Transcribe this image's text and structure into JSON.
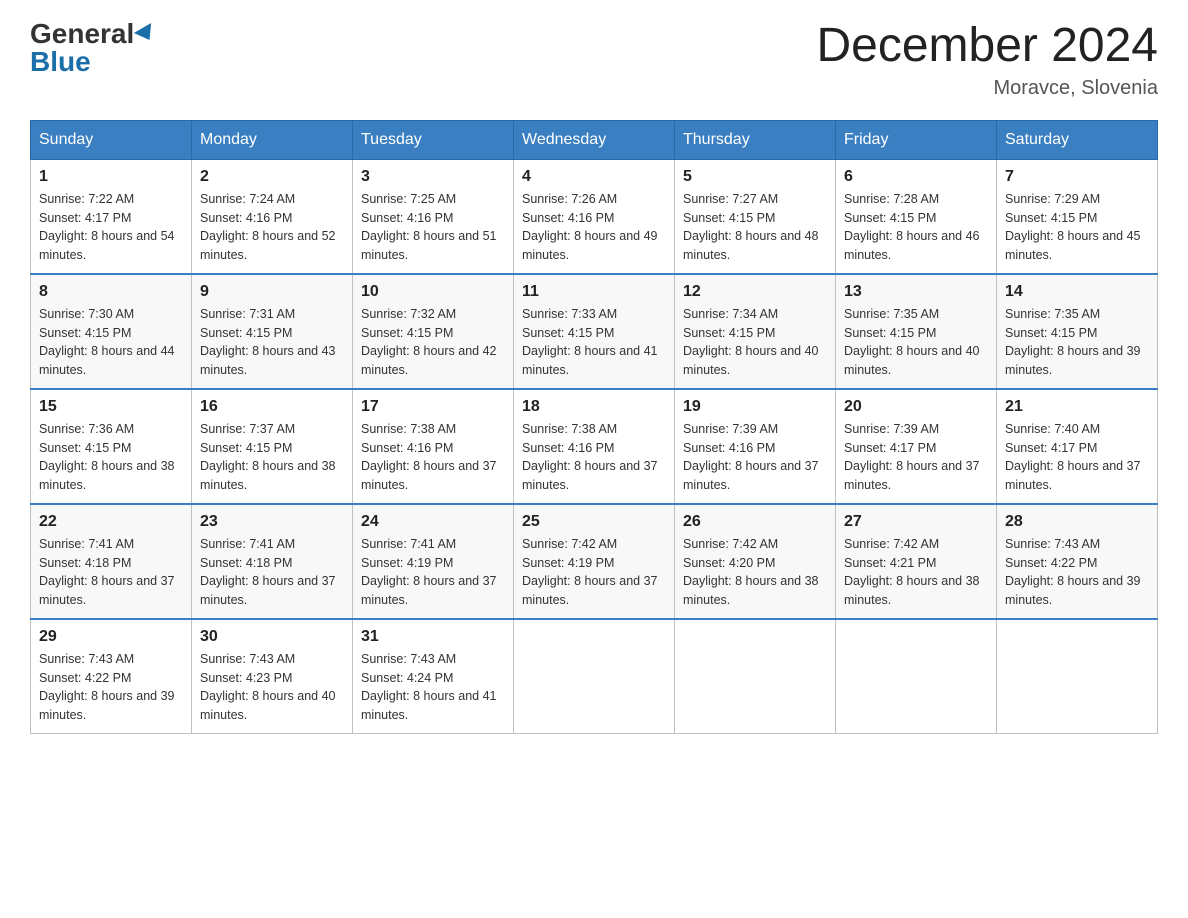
{
  "header": {
    "logo_general": "General",
    "logo_blue": "Blue",
    "month_title": "December 2024",
    "location": "Moravce, Slovenia"
  },
  "weekdays": [
    "Sunday",
    "Monday",
    "Tuesday",
    "Wednesday",
    "Thursday",
    "Friday",
    "Saturday"
  ],
  "weeks": [
    [
      {
        "day": "1",
        "sunrise": "7:22 AM",
        "sunset": "4:17 PM",
        "daylight": "8 hours and 54 minutes."
      },
      {
        "day": "2",
        "sunrise": "7:24 AM",
        "sunset": "4:16 PM",
        "daylight": "8 hours and 52 minutes."
      },
      {
        "day": "3",
        "sunrise": "7:25 AM",
        "sunset": "4:16 PM",
        "daylight": "8 hours and 51 minutes."
      },
      {
        "day": "4",
        "sunrise": "7:26 AM",
        "sunset": "4:16 PM",
        "daylight": "8 hours and 49 minutes."
      },
      {
        "day": "5",
        "sunrise": "7:27 AM",
        "sunset": "4:15 PM",
        "daylight": "8 hours and 48 minutes."
      },
      {
        "day": "6",
        "sunrise": "7:28 AM",
        "sunset": "4:15 PM",
        "daylight": "8 hours and 46 minutes."
      },
      {
        "day": "7",
        "sunrise": "7:29 AM",
        "sunset": "4:15 PM",
        "daylight": "8 hours and 45 minutes."
      }
    ],
    [
      {
        "day": "8",
        "sunrise": "7:30 AM",
        "sunset": "4:15 PM",
        "daylight": "8 hours and 44 minutes."
      },
      {
        "day": "9",
        "sunrise": "7:31 AM",
        "sunset": "4:15 PM",
        "daylight": "8 hours and 43 minutes."
      },
      {
        "day": "10",
        "sunrise": "7:32 AM",
        "sunset": "4:15 PM",
        "daylight": "8 hours and 42 minutes."
      },
      {
        "day": "11",
        "sunrise": "7:33 AM",
        "sunset": "4:15 PM",
        "daylight": "8 hours and 41 minutes."
      },
      {
        "day": "12",
        "sunrise": "7:34 AM",
        "sunset": "4:15 PM",
        "daylight": "8 hours and 40 minutes."
      },
      {
        "day": "13",
        "sunrise": "7:35 AM",
        "sunset": "4:15 PM",
        "daylight": "8 hours and 40 minutes."
      },
      {
        "day": "14",
        "sunrise": "7:35 AM",
        "sunset": "4:15 PM",
        "daylight": "8 hours and 39 minutes."
      }
    ],
    [
      {
        "day": "15",
        "sunrise": "7:36 AM",
        "sunset": "4:15 PM",
        "daylight": "8 hours and 38 minutes."
      },
      {
        "day": "16",
        "sunrise": "7:37 AM",
        "sunset": "4:15 PM",
        "daylight": "8 hours and 38 minutes."
      },
      {
        "day": "17",
        "sunrise": "7:38 AM",
        "sunset": "4:16 PM",
        "daylight": "8 hours and 37 minutes."
      },
      {
        "day": "18",
        "sunrise": "7:38 AM",
        "sunset": "4:16 PM",
        "daylight": "8 hours and 37 minutes."
      },
      {
        "day": "19",
        "sunrise": "7:39 AM",
        "sunset": "4:16 PM",
        "daylight": "8 hours and 37 minutes."
      },
      {
        "day": "20",
        "sunrise": "7:39 AM",
        "sunset": "4:17 PM",
        "daylight": "8 hours and 37 minutes."
      },
      {
        "day": "21",
        "sunrise": "7:40 AM",
        "sunset": "4:17 PM",
        "daylight": "8 hours and 37 minutes."
      }
    ],
    [
      {
        "day": "22",
        "sunrise": "7:41 AM",
        "sunset": "4:18 PM",
        "daylight": "8 hours and 37 minutes."
      },
      {
        "day": "23",
        "sunrise": "7:41 AM",
        "sunset": "4:18 PM",
        "daylight": "8 hours and 37 minutes."
      },
      {
        "day": "24",
        "sunrise": "7:41 AM",
        "sunset": "4:19 PM",
        "daylight": "8 hours and 37 minutes."
      },
      {
        "day": "25",
        "sunrise": "7:42 AM",
        "sunset": "4:19 PM",
        "daylight": "8 hours and 37 minutes."
      },
      {
        "day": "26",
        "sunrise": "7:42 AM",
        "sunset": "4:20 PM",
        "daylight": "8 hours and 38 minutes."
      },
      {
        "day": "27",
        "sunrise": "7:42 AM",
        "sunset": "4:21 PM",
        "daylight": "8 hours and 38 minutes."
      },
      {
        "day": "28",
        "sunrise": "7:43 AM",
        "sunset": "4:22 PM",
        "daylight": "8 hours and 39 minutes."
      }
    ],
    [
      {
        "day": "29",
        "sunrise": "7:43 AM",
        "sunset": "4:22 PM",
        "daylight": "8 hours and 39 minutes."
      },
      {
        "day": "30",
        "sunrise": "7:43 AM",
        "sunset": "4:23 PM",
        "daylight": "8 hours and 40 minutes."
      },
      {
        "day": "31",
        "sunrise": "7:43 AM",
        "sunset": "4:24 PM",
        "daylight": "8 hours and 41 minutes."
      },
      null,
      null,
      null,
      null
    ]
  ],
  "labels": {
    "sunrise": "Sunrise:",
    "sunset": "Sunset:",
    "daylight": "Daylight:"
  }
}
